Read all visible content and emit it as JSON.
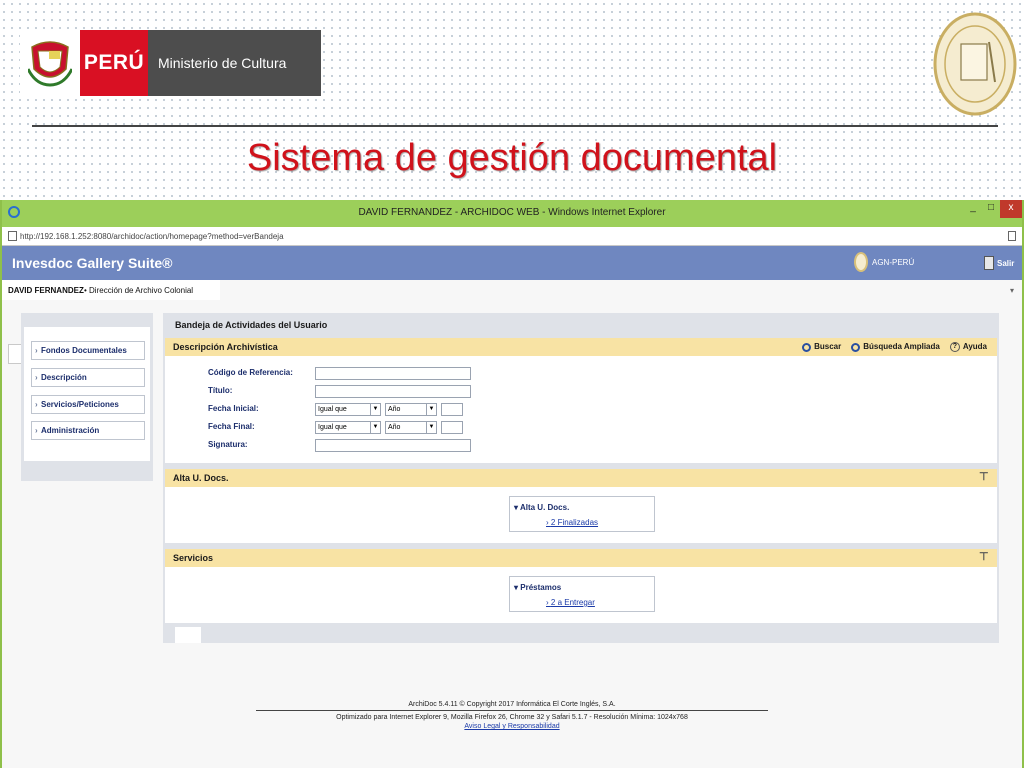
{
  "header": {
    "peru_label": "PERÚ",
    "ministry_label": "Ministerio de Cultura",
    "slide_title": "Sistema de gestión documental"
  },
  "browser": {
    "window_title": "DAVID FERNANDEZ - ARCHIDOC WEB - Windows Internet Explorer",
    "url": "http://192.168.1.252:8080/archidoc/action/homepage?method=verBandeja",
    "controls": {
      "minimize": "_",
      "maximize": "□",
      "close": "x"
    }
  },
  "app": {
    "brand": "Invesdoc Gallery Suite®",
    "agn_label": "AGN-PERÚ",
    "exit_label": "Salir",
    "user_name": "DAVID FERNANDEZ",
    "department": "• Dirección de Archivo Colonial"
  },
  "sidebar": {
    "items": [
      {
        "label": "Fondos Documentales"
      },
      {
        "label": "Descripción"
      },
      {
        "label": "Servicios/Peticiones"
      },
      {
        "label": "Administración"
      }
    ]
  },
  "main": {
    "title": "Bandeja de Actividades del Usuario",
    "descripcion": {
      "header": "Descripción Archivística",
      "tools": {
        "buscar": "Buscar",
        "busqueda_ampliada": "Búsqueda Ampliada",
        "ayuda": "Ayuda"
      },
      "fields": {
        "codigo": "Código de Referencia:",
        "titulo": "Título:",
        "fecha_inicial": "Fecha Inicial:",
        "fecha_final": "Fecha Final:",
        "signatura": "Signatura:"
      },
      "select_op": "Igual que",
      "select_unit": "Año"
    },
    "alta": {
      "header": "Alta U. Docs.",
      "tree_title": "Alta U. Docs.",
      "tree_link": "2 Finalizadas"
    },
    "servicios": {
      "header": "Servicios",
      "tree_title": "Préstamos",
      "tree_link": "2 a Entregar"
    }
  },
  "footer": {
    "line1": "ArchiDoc 5.4.11 © Copyright 2017 Informática El Corte Inglés, S.A.",
    "line2": "Optimizado para Internet Explorer 9, Mozilla Firefox 26, Chrome 32 y Safari 5.1.7 - Resolución Mínima: 1024x768",
    "link": "Aviso Legal y Responsabilidad"
  }
}
